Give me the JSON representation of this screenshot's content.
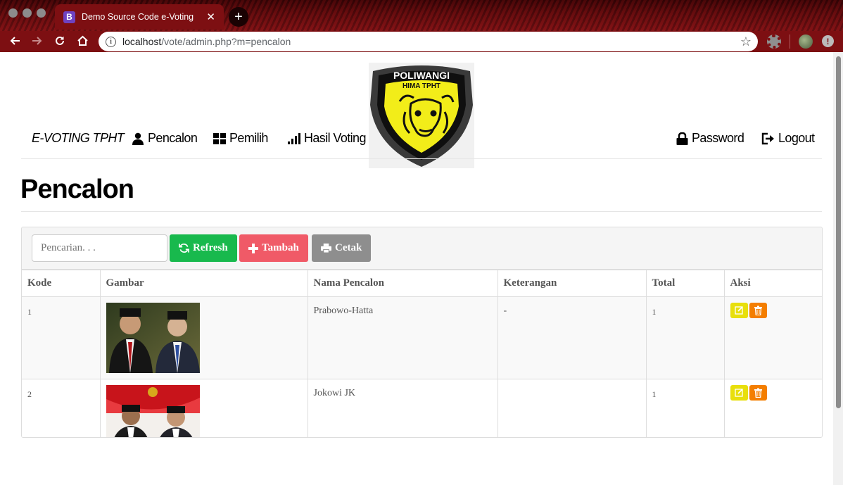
{
  "browser": {
    "tab_title": "Demo Source Code e-Voting",
    "tab_favicon_letter": "B",
    "new_tab_label": "+",
    "url_host": "localhost",
    "url_path": "/vote/admin.php?m=pencalon"
  },
  "logo": {
    "top_text": "POLIWANGI",
    "sub_text": "HIMA TPHT",
    "icon": "bull-shield-logo"
  },
  "navbar": {
    "brand": "E-VOTING TPHT",
    "items": [
      {
        "label": "Pencalon",
        "icon": "user-icon"
      },
      {
        "label": "Pemilih",
        "icon": "grid-icon"
      },
      {
        "label": "Hasil Voting",
        "icon": "signal-bars-icon"
      }
    ],
    "right_items": [
      {
        "label": "Password",
        "icon": "lock-icon"
      },
      {
        "label": "Logout",
        "icon": "logout-icon"
      }
    ]
  },
  "page_title": "Pencalon",
  "search": {
    "placeholder": "Pencarian. . ."
  },
  "buttons": {
    "refresh": "Refresh",
    "tambah": "Tambah",
    "cetak": "Cetak"
  },
  "colors": {
    "refresh": "#18b94d",
    "tambah": "#f05a67",
    "cetak": "#8e8e8e",
    "edit": "#e8df0c",
    "delete": "#f47e00",
    "browser_frame": "#7d0f12"
  },
  "table": {
    "columns": [
      "Kode",
      "Gambar",
      "Nama Pencalon",
      "Keterangan",
      "Total",
      "Aksi"
    ],
    "rows": [
      {
        "kode": "1",
        "nama": "Prabowo-Hatta",
        "keterangan": "-",
        "total": "1"
      },
      {
        "kode": "2",
        "nama": "Jokowi JK",
        "keterangan": "",
        "total": "1"
      }
    ]
  }
}
